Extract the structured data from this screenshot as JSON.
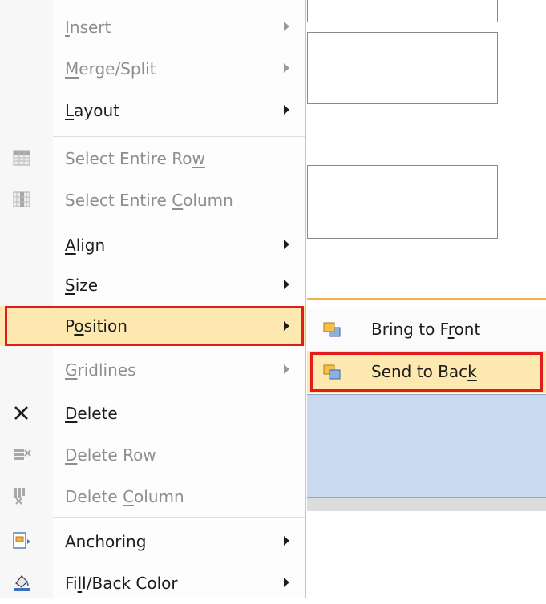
{
  "menu": {
    "items": [
      {
        "label": "Insert",
        "ul": "I",
        "rest": "nsert",
        "disabled": true,
        "submenu": true,
        "icon": ""
      },
      {
        "label": "Merge/Split",
        "ul": "M",
        "rest": "erge/Split",
        "disabled": true,
        "submenu": true,
        "icon": ""
      },
      {
        "label": "Layout",
        "ul": "L",
        "rest": "ayout",
        "disabled": false,
        "submenu": true,
        "icon": ""
      },
      {
        "label": "Select Entire Row",
        "pre": "Select Entire Ro",
        "ul": "w",
        "rest": "",
        "disabled": true,
        "submenu": false,
        "icon": "select-row-icon"
      },
      {
        "label": "Select Entire Column",
        "pre": "Select Entire ",
        "ul": "C",
        "rest": "olumn",
        "disabled": true,
        "submenu": false,
        "icon": "select-column-icon"
      },
      {
        "label": "Align",
        "ul": "A",
        "rest": "lign",
        "disabled": false,
        "submenu": true,
        "icon": ""
      },
      {
        "label": "Size",
        "ul": "S",
        "rest": "ize",
        "disabled": false,
        "submenu": true,
        "icon": ""
      },
      {
        "label": "Position",
        "pre": "P",
        "ul": "o",
        "rest": "sition",
        "disabled": false,
        "submenu": true,
        "icon": "",
        "highlighted": true
      },
      {
        "label": "Gridlines",
        "ul": "G",
        "rest": "ridlines",
        "disabled": true,
        "submenu": true,
        "icon": ""
      },
      {
        "label": "Delete",
        "ul": "D",
        "rest": "elete",
        "disabled": false,
        "submenu": false,
        "icon": "delete-x-icon"
      },
      {
        "label": "Delete Row",
        "ul": "D",
        "rest": "elete Row",
        "disabled": true,
        "submenu": false,
        "icon": "delete-row-icon"
      },
      {
        "label": "Delete Column",
        "pre": "Delete ",
        "ul": "C",
        "rest": "olumn",
        "disabled": true,
        "submenu": false,
        "icon": "delete-column-icon"
      },
      {
        "label": "Anchoring",
        "pre": "",
        "ul": "",
        "rest": "Anchoring",
        "disabled": false,
        "submenu": true,
        "icon": "anchoring-icon"
      },
      {
        "label": "Fill/Back Color",
        "pre": "Fi",
        "ul": "l",
        "rest": "l/Back Color",
        "disabled": false,
        "submenu": true,
        "icon": "fill-color-icon",
        "split": true
      }
    ]
  },
  "submenu": {
    "items": [
      {
        "label": "Bring to Front",
        "pre": "Bring to F",
        "ul": "r",
        "rest": "ont",
        "icon": "bring-to-front-icon",
        "highlighted": false
      },
      {
        "label": "Send to Back",
        "pre": "Send to Bac",
        "ul": "k",
        "rest": "",
        "icon": "send-to-back-icon",
        "highlighted": true
      }
    ]
  },
  "colors": {
    "highlight": "#fde9b0",
    "annotation_red": "#e01c1c",
    "table_blue": "#c9d9ef",
    "accent_orange": "#f2b24a"
  }
}
